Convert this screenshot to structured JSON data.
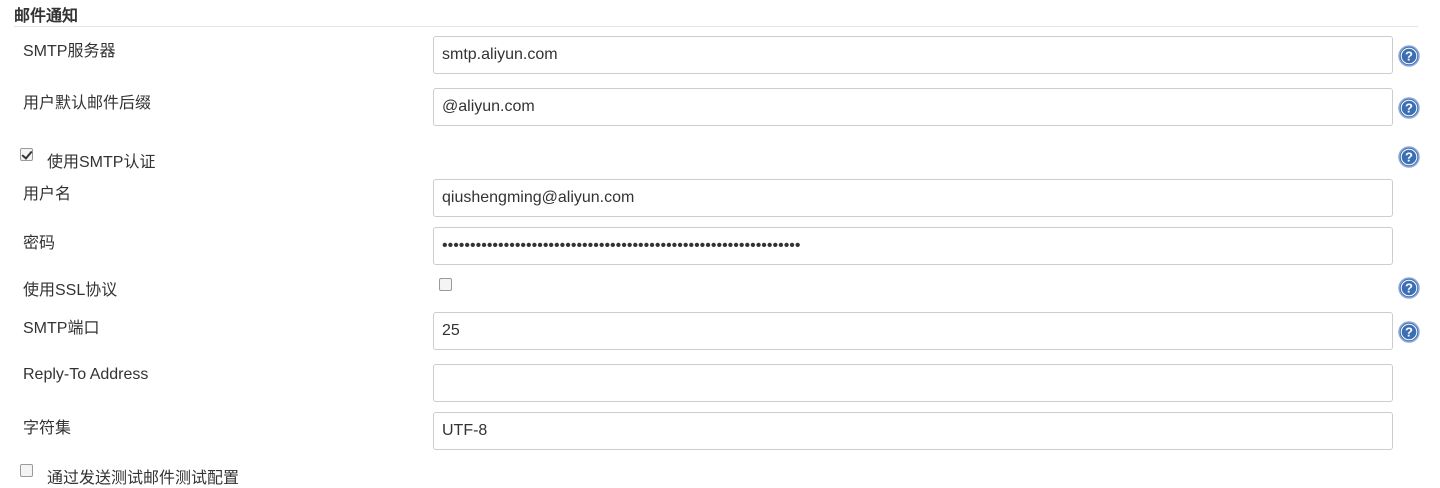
{
  "section": {
    "title": "邮件通知"
  },
  "fields": {
    "smtp_server": {
      "label": "SMTP服务器",
      "value": "smtp.aliyun.com"
    },
    "default_suffix": {
      "label": "用户默认邮件后缀",
      "value": "@aliyun.com"
    },
    "use_smtp_auth": {
      "label": "使用SMTP认证",
      "checked": true
    },
    "username": {
      "label": "用户名",
      "value": "qiushengming@aliyun.com"
    },
    "password": {
      "label": "密码",
      "value": "••••••••••••••••••••••••••••••••••••••••••••••••••••••••••••••••"
    },
    "use_ssl": {
      "label": "使用SSL协议",
      "checked": false
    },
    "smtp_port": {
      "label": "SMTP端口",
      "value": "25"
    },
    "reply_to": {
      "label": "Reply-To Address",
      "value": ""
    },
    "charset": {
      "label": "字符集",
      "value": "UTF-8"
    },
    "test_config": {
      "label": "通过发送测试邮件测试配置",
      "checked": false
    }
  },
  "colors": {
    "help_icon": "#3c6eb4",
    "border": "#cccccc",
    "text": "#333333"
  }
}
